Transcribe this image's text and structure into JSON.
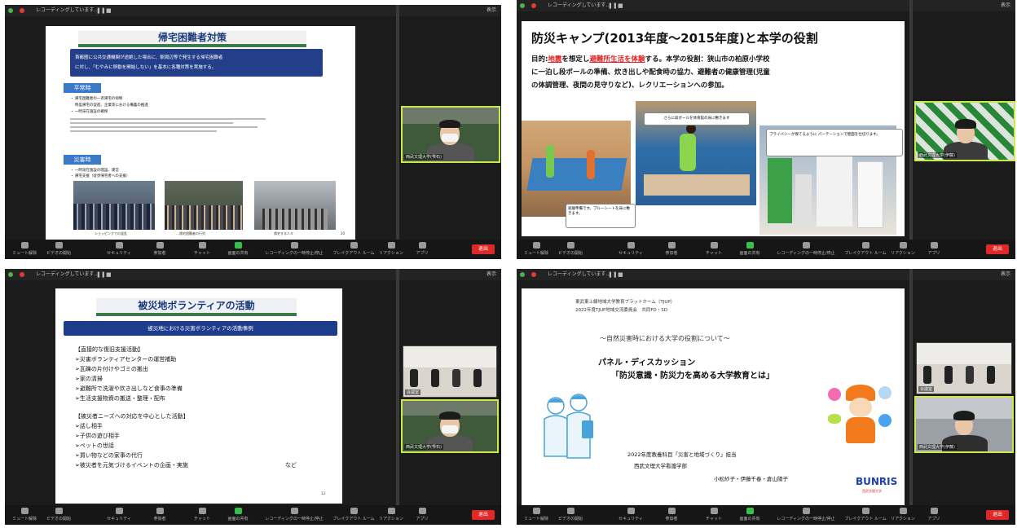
{
  "zoom": {
    "window_title": "レコーディングしています…",
    "top_right": "表示",
    "end_label": "退出",
    "toolbar": [
      "ミュート解除",
      "ビデオの開始",
      "セキュリティ",
      "参加者",
      "チャット",
      "画面の共有",
      "レコーディングの一時停止/停止",
      "ブレイクアウト ルーム",
      "リアクション",
      "アプリ"
    ]
  },
  "panel1": {
    "title": "帰宅困難者対策",
    "box_text_1": "首都圏に公共交通機関が途絶した場合に、駅周辺等で発生する帰宅困難者",
    "box_text_2": "に対し、「むやみに移動を開始しない」を基本に各種対策を実施する。",
    "sec1": "平常時",
    "sec1_lines": [
      "・ 帰宅困難者の一斉帰宅の抑制",
      "　 時差帰宅の促進、企業等における備蓄の推進",
      "・ 一時滞在施設の確保"
    ],
    "sec2": "災害時",
    "sec2_lines": [
      "・ 一時滞在施設の開設、運営",
      "・ 帰宅支援（徒歩帰宅者への支援）"
    ],
    "captions": [
      "ショッピングでの混乱",
      "…帰宅困難者の行列",
      "帰宅する人々"
    ],
    "page": "20",
    "video_name": "西武文理大学(雫石)"
  },
  "panel2": {
    "title": "防災キャンプ(2013年度〜2015年度)と本学の役割",
    "purpose_label": "目的:",
    "purpose_red": "地震",
    "purpose_1": "を想定し",
    "purpose_red2": "避難所生活を体験",
    "purpose_2": "する。本学の役割：狭山市の柏原小学校",
    "line2": "に一泊し段ボールの準備、炊き出しや配食時の協力、避難者の健康管理(児童",
    "line3": "の体調管理、夜間の見守りなど)、レクリエーションへの参加。",
    "cap1": "さらに段ボールを体育館の床に敷きます",
    "cap2": "プライバシーが保てるように パーテーションで壁面を仕切ります。",
    "cap3": "就寝準備です。ブルーシートを床に敷きます。",
    "video_name": "西武文理大学(伊藤)"
  },
  "panel3": {
    "title": "被災地ボランティアの活動",
    "subtitle": "被災地における災害ボランティアの活動事例",
    "group1_head": "【直接的な復旧支援活動】",
    "group1": [
      "➢災害ボランティアセンターの運営補助",
      "➢瓦礫の片付けやゴミの搬出",
      "➢家の清掃",
      "➢避難所で洗濯や炊き出しなど食事の準備",
      "➢生活支援物資の搬送・整理・配布"
    ],
    "group2_head": "【被災者ニーズへの対応を中心とした活動】",
    "group2": [
      "➢話し相手",
      "➢子供の遊び相手",
      "➢ペットの世話",
      "➢買い物などの家事の代行",
      "➢被災者を元気づけるイベントの企画・実施"
    ],
    "etc": "など",
    "page": "12",
    "video_name_1": "会議室",
    "video_name_2": "西武文理大学(雫石)"
  },
  "panel4": {
    "org_1": "東武東上線地域大学教育プラットホーム（TJUP）",
    "org_2": "2022年度TJUP地域交流委員会　共同FD・SD",
    "theme": "〜自然災害時における大学の役割について〜",
    "heading_1": "パネル・ディスカッション",
    "heading_2": "「防災意識・防災力を高める大学教育とは」",
    "course": "2022年度教養科目「災害と地域づくり」担当",
    "faculty": "西武文理大学看護学部",
    "names": "小松紗子・伊藤千春・倉山陽子",
    "logo": "BUNRIS",
    "logo_sub": "西武文理大学",
    "video_name_1": "会議室",
    "video_name_2": "西武文理大学(伊藤)"
  }
}
